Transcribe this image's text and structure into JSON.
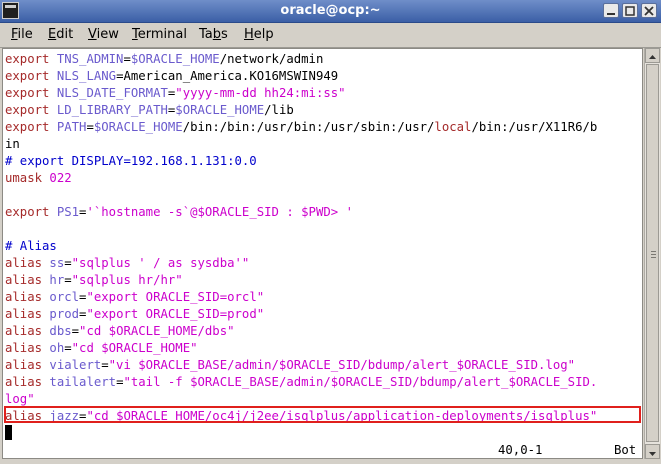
{
  "window": {
    "title": "oracle@ocp:~"
  },
  "menu": [
    {
      "label": "File",
      "mnemonic": "F",
      "rest": "ile"
    },
    {
      "label": "Edit",
      "mnemonic": "E",
      "rest": "dit"
    },
    {
      "label": "View",
      "mnemonic": "V",
      "rest": "iew"
    },
    {
      "label": "Terminal",
      "mnemonic": "T",
      "rest": "erminal"
    },
    {
      "label": "Tabs",
      "mnemonic": "b",
      "pre": "Ta",
      "rest": "s"
    },
    {
      "label": "Help",
      "mnemonic": "H",
      "rest": "elp"
    }
  ],
  "terminal": {
    "lines": [
      [
        {
          "t": "export ",
          "c": "kw"
        },
        {
          "t": "TNS_ADMIN",
          "c": "var"
        },
        {
          "t": "=",
          "c": "plain"
        },
        {
          "t": "$ORACLE_HOME",
          "c": "var"
        },
        {
          "t": "/network/admin",
          "c": "plain"
        }
      ],
      [
        {
          "t": "export ",
          "c": "kw"
        },
        {
          "t": "NLS_LANG",
          "c": "var"
        },
        {
          "t": "=American_America.KO16MSWIN949",
          "c": "plain"
        }
      ],
      [
        {
          "t": "export ",
          "c": "kw"
        },
        {
          "t": "NLS_DATE_FORMAT",
          "c": "var"
        },
        {
          "t": "=",
          "c": "plain"
        },
        {
          "t": "\"yyyy-mm-dd hh24:mi:ss\"",
          "c": "str"
        }
      ],
      [
        {
          "t": "export ",
          "c": "kw"
        },
        {
          "t": "LD_LIBRARY_PATH",
          "c": "var"
        },
        {
          "t": "=",
          "c": "plain"
        },
        {
          "t": "$ORACLE_HOME",
          "c": "var"
        },
        {
          "t": "/lib",
          "c": "plain"
        }
      ],
      [
        {
          "t": "export ",
          "c": "kw"
        },
        {
          "t": "PATH",
          "c": "var"
        },
        {
          "t": "=",
          "c": "plain"
        },
        {
          "t": "$ORACLE_HOME",
          "c": "var"
        },
        {
          "t": "/bin:/bin:/usr/bin:/usr/sbin:/usr/",
          "c": "plain"
        },
        {
          "t": "local",
          "c": "kw"
        },
        {
          "t": "/bin:/usr/X11R6/b",
          "c": "plain"
        }
      ],
      [
        {
          "t": "in",
          "c": "plain"
        }
      ],
      [
        {
          "t": "# export DISPLAY=192.168.1.131:0.0",
          "c": "cmt"
        }
      ],
      [
        {
          "t": "umask ",
          "c": "kw"
        },
        {
          "t": "022",
          "c": "num"
        }
      ],
      [],
      [
        {
          "t": "export ",
          "c": "kw"
        },
        {
          "t": "PS1",
          "c": "var"
        },
        {
          "t": "=",
          "c": "plain"
        },
        {
          "t": "'`hostname -s`@$ORACLE_SID : $PWD> '",
          "c": "str"
        }
      ],
      [],
      [
        {
          "t": "# Alias",
          "c": "cmt"
        }
      ],
      [
        {
          "t": "alias ",
          "c": "kw"
        },
        {
          "t": "ss",
          "c": "var"
        },
        {
          "t": "=",
          "c": "plain"
        },
        {
          "t": "\"sqlplus ' / as sysdba'\"",
          "c": "str"
        }
      ],
      [
        {
          "t": "alias ",
          "c": "kw"
        },
        {
          "t": "hr",
          "c": "var"
        },
        {
          "t": "=",
          "c": "plain"
        },
        {
          "t": "\"sqlplus hr/hr\"",
          "c": "str"
        }
      ],
      [
        {
          "t": "alias ",
          "c": "kw"
        },
        {
          "t": "orcl",
          "c": "var"
        },
        {
          "t": "=",
          "c": "plain"
        },
        {
          "t": "\"export ORACLE_SID=orcl\"",
          "c": "str"
        }
      ],
      [
        {
          "t": "alias ",
          "c": "kw"
        },
        {
          "t": "prod",
          "c": "var"
        },
        {
          "t": "=",
          "c": "plain"
        },
        {
          "t": "\"export ORACLE_SID=prod\"",
          "c": "str"
        }
      ],
      [
        {
          "t": "alias ",
          "c": "kw"
        },
        {
          "t": "dbs",
          "c": "var"
        },
        {
          "t": "=",
          "c": "plain"
        },
        {
          "t": "\"cd $ORACLE_HOME/dbs\"",
          "c": "str"
        }
      ],
      [
        {
          "t": "alias ",
          "c": "kw"
        },
        {
          "t": "oh",
          "c": "var"
        },
        {
          "t": "=",
          "c": "plain"
        },
        {
          "t": "\"cd $ORACLE_HOME\"",
          "c": "str"
        }
      ],
      [
        {
          "t": "alias ",
          "c": "kw"
        },
        {
          "t": "vialert",
          "c": "var"
        },
        {
          "t": "=",
          "c": "plain"
        },
        {
          "t": "\"vi $ORACLE_BASE/admin/$ORACLE_SID/bdump/alert_$ORACLE_SID.log\"",
          "c": "str"
        }
      ],
      [
        {
          "t": "alias ",
          "c": "kw"
        },
        {
          "t": "tailalert",
          "c": "var"
        },
        {
          "t": "=",
          "c": "plain"
        },
        {
          "t": "\"tail -f $ORACLE_BASE/admin/$ORACLE_SID/bdump/alert_$ORACLE_SID.",
          "c": "str"
        }
      ],
      [
        {
          "t": "log\"",
          "c": "str"
        }
      ],
      [
        {
          "t": "alias ",
          "c": "kw"
        },
        {
          "t": "jazz",
          "c": "var"
        },
        {
          "t": "=",
          "c": "plain"
        },
        {
          "t": "\"cd $ORACLE_HOME/oc4j/j2ee/isqlplus/application-deployments/isqlplus\"",
          "c": "str"
        }
      ]
    ],
    "status_position": "40,0-1",
    "status_scroll": "Bot"
  },
  "colors": {
    "keyword": "#a52a2a",
    "variable": "#6a5acd",
    "string": "#cc00cc",
    "comment": "#0000cc",
    "highlight": "#e0201c"
  }
}
